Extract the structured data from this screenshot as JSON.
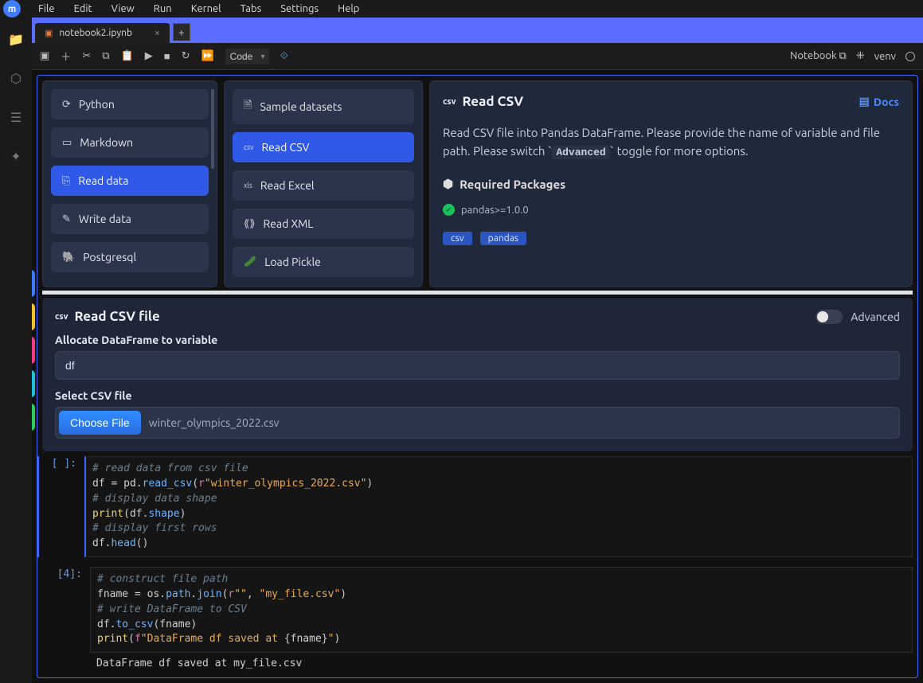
{
  "menu": {
    "items": [
      "File",
      "Edit",
      "View",
      "Run",
      "Kernel",
      "Tabs",
      "Settings",
      "Help"
    ],
    "logo": "m"
  },
  "tab": {
    "title": "notebook2.ipynb"
  },
  "toolbar": {
    "cellType": "Code",
    "right": {
      "mode": "Notebook",
      "kernel": "venv"
    }
  },
  "recipe": {
    "colA": [
      {
        "icon": "⟳",
        "label": "Python"
      },
      {
        "icon": "▭",
        "label": "Markdown"
      },
      {
        "icon": "⎘",
        "label": "Read data",
        "active": true
      },
      {
        "icon": "✎",
        "label": "Write data"
      },
      {
        "icon": "🐘",
        "label": "Postgresql"
      }
    ],
    "colB": [
      {
        "icon": "🗎",
        "label": "Sample datasets"
      },
      {
        "icon": "csv",
        "label": "Read CSV",
        "active": true
      },
      {
        "icon": "xls",
        "label": "Read Excel"
      },
      {
        "icon": "⟪⟫",
        "label": "Read XML"
      },
      {
        "icon": "🥒",
        "label": "Load Pickle"
      }
    ],
    "detail": {
      "title": "Read CSV",
      "docs": "Docs",
      "desc_pre": "Read CSV file into Pandas DataFrame. Please provide the name of variable and file path. Please switch ",
      "desc_adv": "Advanced",
      "desc_post": " toggle for more options.",
      "reqTitle": "Required Packages",
      "pkg": "pandas>=1.0.0",
      "tags": [
        "csv",
        "pandas"
      ]
    }
  },
  "form": {
    "title": "Read CSV file",
    "advancedLabel": "Advanced",
    "label1": "Allocate DataFrame to variable",
    "value1": "df",
    "label2": "Select CSV file",
    "chooseBtn": "Choose File",
    "filename": "winter_olympics_2022.csv"
  },
  "cells": [
    {
      "prompt": "[ ]:",
      "active": true,
      "code_html": "<span class='tok-c'># read data from csv file</span>\n<span class='tok-v'>df</span> <span class='tok-o'>=</span> <span class='tok-v'>pd</span>.<span class='tok-f'>read_csv</span>(<span class='tok-k'>r</span><span class='tok-s'>\"winter_olympics_2022.csv\"</span>)\n<span class='tok-c'># display data shape</span>\n<span class='tok-n'>print</span>(<span class='tok-v'>df</span>.<span class='tok-f'>shape</span>)\n<span class='tok-c'># display first rows</span>\n<span class='tok-v'>df</span>.<span class='tok-f'>head</span>()"
    },
    {
      "prompt": "[4]:",
      "code_html": "<span class='tok-c'># construct file path</span>\n<span class='tok-v'>fname</span> <span class='tok-o'>=</span> <span class='tok-v'>os</span>.<span class='tok-f'>path</span>.<span class='tok-f'>join</span>(<span class='tok-k'>r</span><span class='tok-s'>\"\"</span>, <span class='tok-s'>\"my_file.csv\"</span>)\n<span class='tok-c'># write DataFrame to CSV</span>\n<span class='tok-v'>df</span>.<span class='tok-f'>to_csv</span>(<span class='tok-v'>fname</span>)\n<span class='tok-n'>print</span>(<span class='tok-k'>f</span><span class='tok-s'>\"DataFrame df saved at </span>{<span class='tok-v'>fname</span>}<span class='tok-s'>\"</span>)",
      "output": "DataFrame df saved at my_file.csv"
    }
  ]
}
